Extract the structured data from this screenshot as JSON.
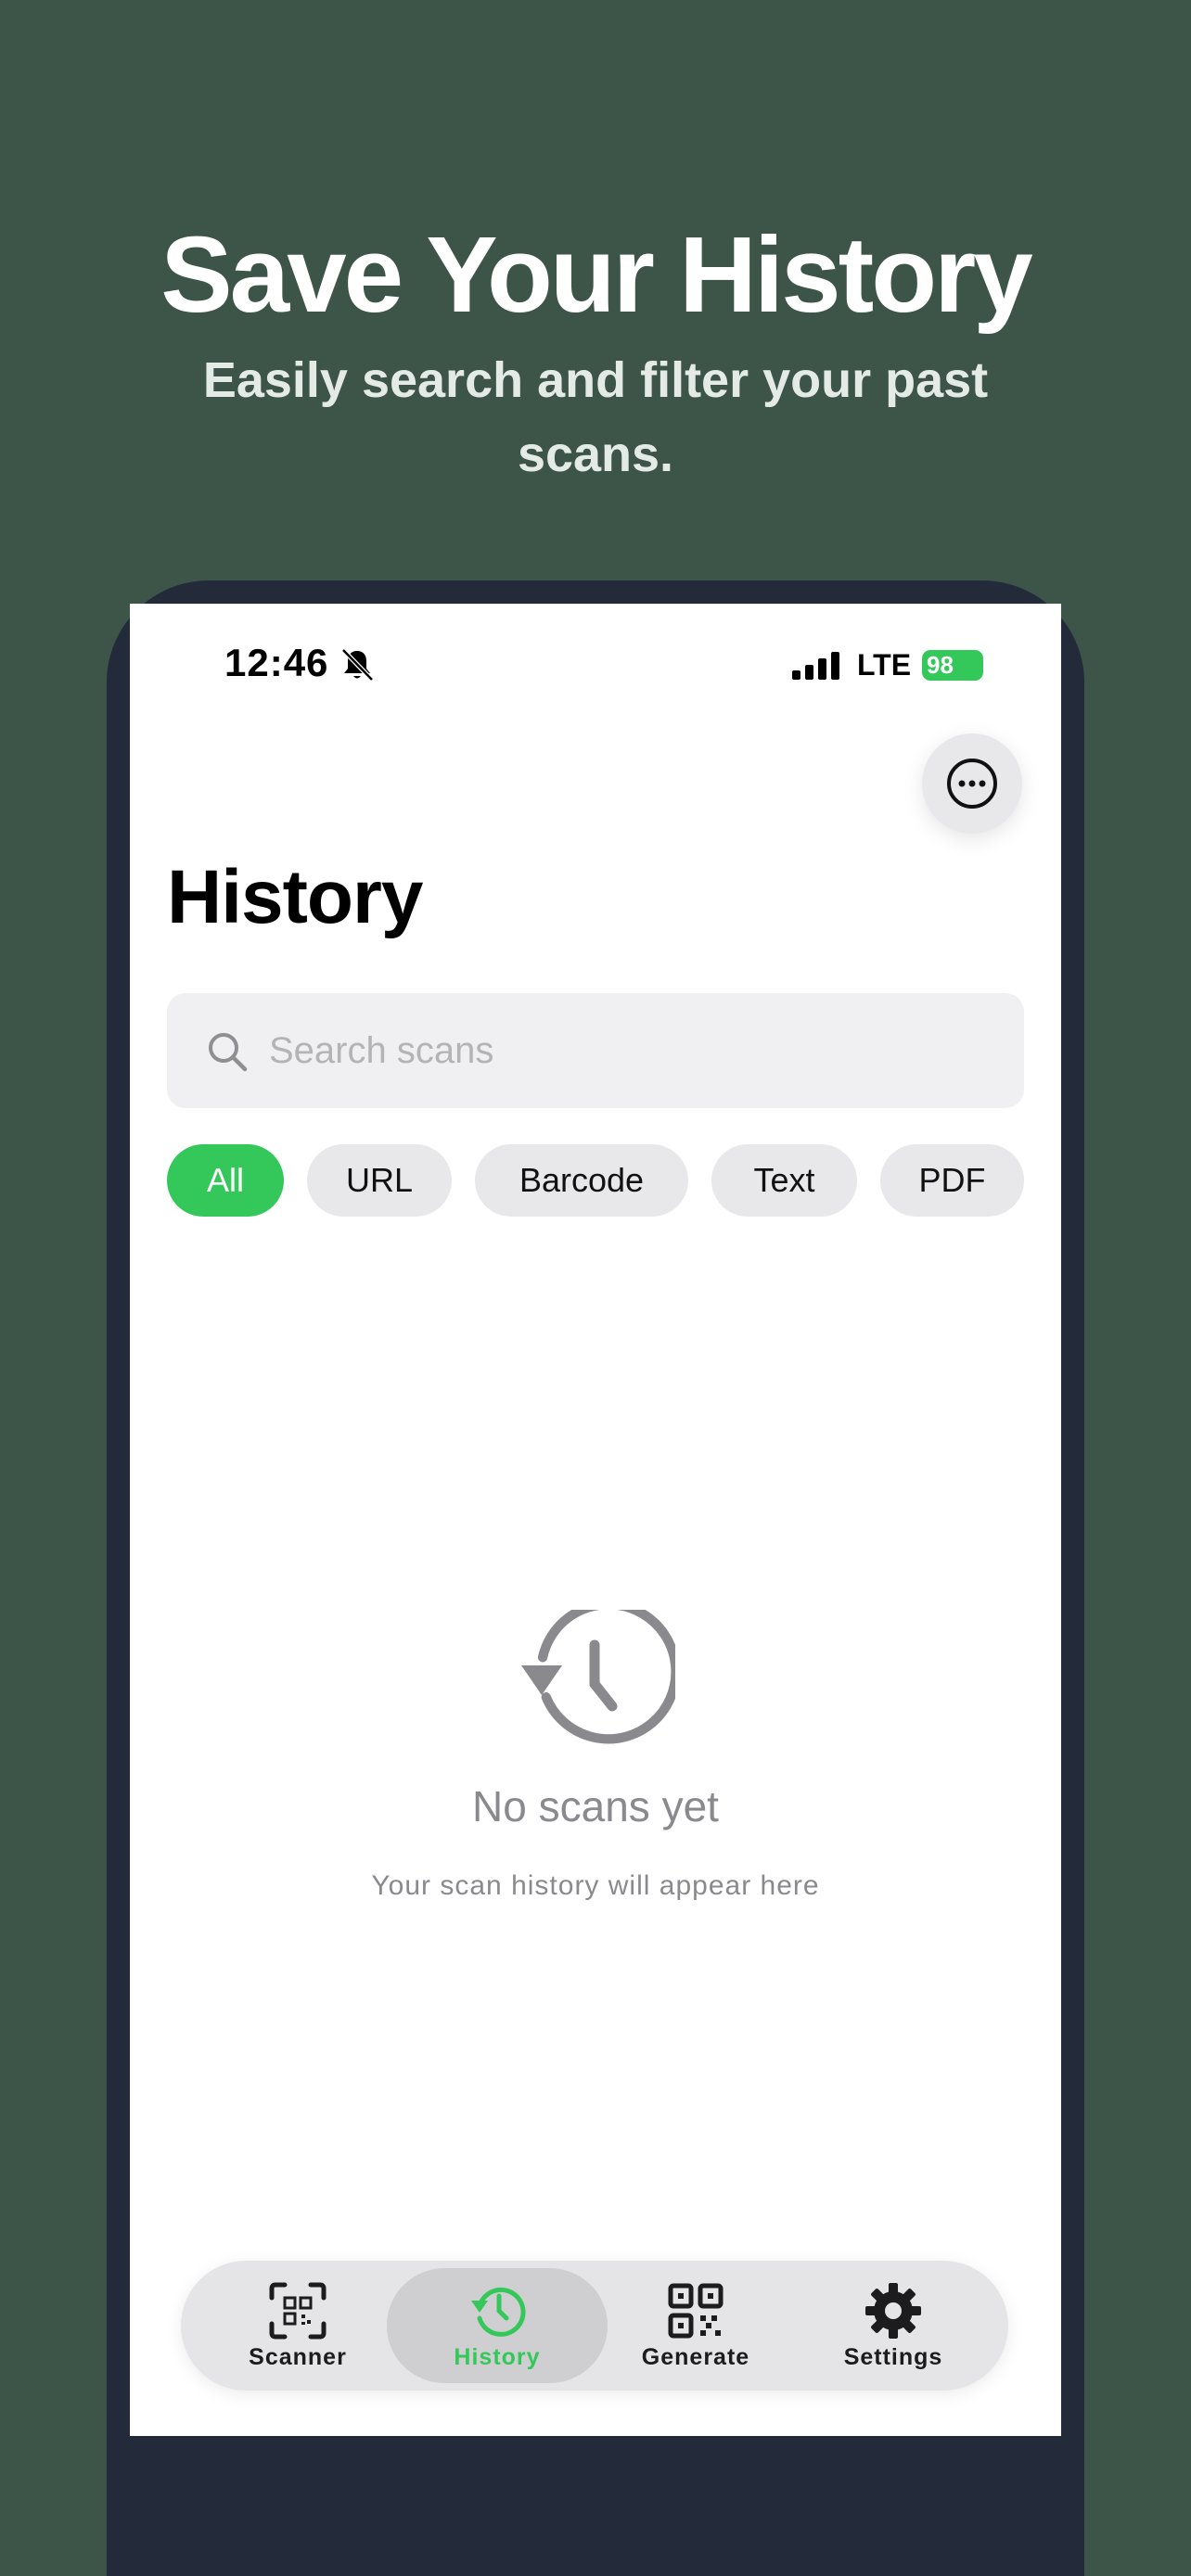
{
  "promo": {
    "title": "Save Your History",
    "subtitle": "Easily search and filter your past scans."
  },
  "status_bar": {
    "time": "12:46",
    "network": "LTE",
    "battery": "98"
  },
  "header": {
    "title": "History",
    "more_icon": "ellipsis-circle-icon"
  },
  "search": {
    "placeholder": "Search scans",
    "value": ""
  },
  "filters": {
    "selected": "All",
    "items": [
      "All",
      "URL",
      "Barcode",
      "Text",
      "PDF"
    ]
  },
  "empty_state": {
    "icon": "history-clock-icon",
    "title": "No scans yet",
    "subtitle": "Your scan history will appear here"
  },
  "tab_bar": {
    "active": "History",
    "items": [
      {
        "label": "Scanner",
        "icon": "qr-scan-icon"
      },
      {
        "label": "History",
        "icon": "history-clock-icon"
      },
      {
        "label": "Generate",
        "icon": "qr-code-icon"
      },
      {
        "label": "Settings",
        "icon": "gear-icon"
      }
    ]
  },
  "colors": {
    "accent": "#34c759",
    "background": "#3d5449",
    "frame": "#232b3a"
  }
}
